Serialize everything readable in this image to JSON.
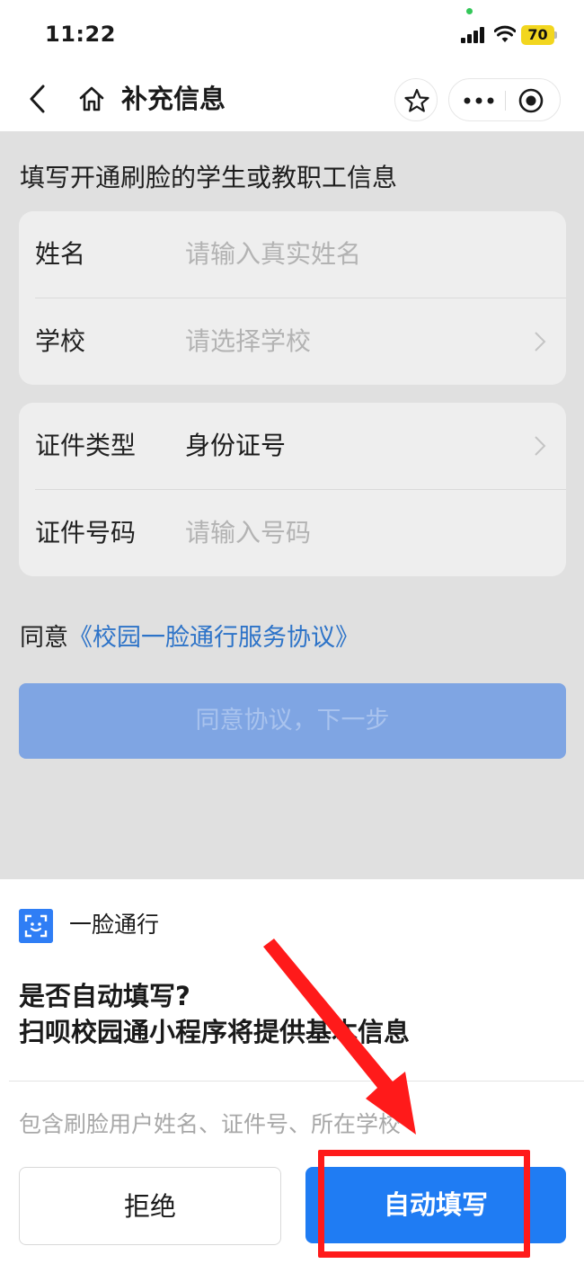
{
  "status_bar": {
    "time": "11:22",
    "battery": "70"
  },
  "nav": {
    "title": "补充信息",
    "icons": [
      "back-arrow-icon",
      "home-icon",
      "star-icon",
      "more-dots-icon",
      "target-icon"
    ]
  },
  "form": {
    "hint": "填写开通刷脸的学生或教职工信息",
    "name_label": "姓名",
    "name_placeholder": "请输入真实姓名",
    "school_label": "学校",
    "school_placeholder": "请选择学校",
    "id_type_label": "证件类型",
    "id_type_value": "身份证号",
    "id_number_label": "证件号码",
    "id_number_placeholder": "请输入号码",
    "agree_prefix": "同意",
    "agree_link": "《校园一脸通行服务协议》",
    "next_button": "同意协议，下一步"
  },
  "sheet": {
    "app_name": "一脸通行",
    "question": "是否自动填写?",
    "description": "扫呗校园通小程序将提供基本信息",
    "scope": "包含刷脸用户姓名、证件号、所在学校",
    "reject_button": "拒绝",
    "auto_fill_button": "自动填写"
  },
  "colors": {
    "accent": "#1f7cf3",
    "disabled_button": "#7fa5e3",
    "link": "#2d73c8",
    "annotation": "#ff1a1a"
  }
}
